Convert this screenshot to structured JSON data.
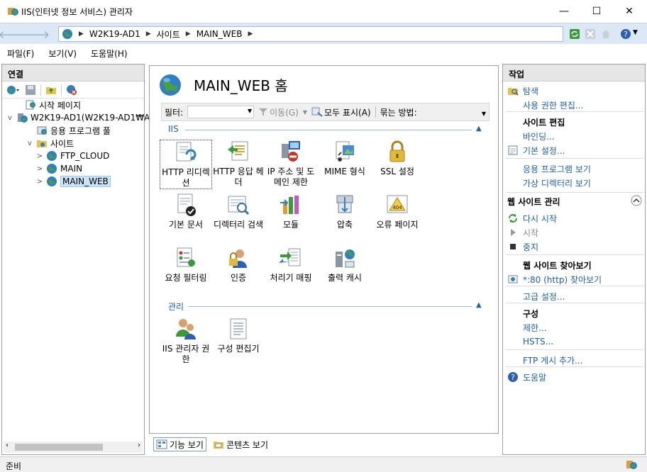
{
  "window": {
    "title": "IIS(인터넷 정보 서비스) 관리자",
    "icon": "iis-manager-icon"
  },
  "window_controls": {
    "minimize": "—",
    "maximize": "☐",
    "close": "✕"
  },
  "address": {
    "crumbs": [
      "W2K19-AD1",
      "사이트",
      "MAIN_WEB"
    ]
  },
  "menu": [
    "파일(F)",
    "보기(V)",
    "도움말(H)"
  ],
  "connections": {
    "title": "연결",
    "tree": [
      {
        "label": "시작 페이지",
        "icon": "start-page-icon",
        "level": 1,
        "expander": ""
      },
      {
        "label": "W2K19-AD1(W2K19-AD1₩A",
        "icon": "server-icon",
        "level": 0,
        "expander": "v"
      },
      {
        "label": "응용 프로그램 풀",
        "icon": "app-pool-icon",
        "level": 2,
        "expander": ""
      },
      {
        "label": "사이트",
        "icon": "sites-folder-icon",
        "level": 2,
        "expander": "v"
      },
      {
        "label": "FTP_CLOUD",
        "icon": "globe-icon",
        "level": 3,
        "expander": ">"
      },
      {
        "label": "MAIN",
        "icon": "globe-icon",
        "level": 3,
        "expander": ">"
      },
      {
        "label": "MAIN_WEB",
        "icon": "globe-icon",
        "level": 3,
        "expander": ">",
        "selected": true
      }
    ]
  },
  "center": {
    "title": "MAIN_WEB 홈",
    "filter": {
      "label": "필터:",
      "go": "이동(G)",
      "show_all": "모두 표시(A)",
      "group_by": "묶는 방법:"
    },
    "groups": [
      {
        "name": "IIS"
      },
      {
        "name": "관리"
      }
    ],
    "iis_features": [
      {
        "label": "HTTP 리디렉션",
        "icon": "http-redirect-icon",
        "selected": true
      },
      {
        "label": "HTTP 응답 헤더",
        "icon": "http-response-headers-icon"
      },
      {
        "label": "IP 주소 및 도메인 제한",
        "icon": "ip-domain-restrictions-icon"
      },
      {
        "label": "MIME 형식",
        "icon": "mime-types-icon"
      },
      {
        "label": "SSL 설정",
        "icon": "ssl-lock-icon"
      },
      {
        "label": "기본 문서",
        "icon": "default-document-icon"
      },
      {
        "label": "디렉터리 검색",
        "icon": "directory-browsing-icon"
      },
      {
        "label": "모듈",
        "icon": "modules-icon"
      },
      {
        "label": "압축",
        "icon": "compression-icon"
      },
      {
        "label": "오류 페이지",
        "icon": "error-pages-icon"
      },
      {
        "label": "요청 필터링",
        "icon": "request-filtering-icon"
      },
      {
        "label": "인증",
        "icon": "authentication-icon"
      },
      {
        "label": "처리기 매핑",
        "icon": "handler-mappings-icon"
      },
      {
        "label": "출력 캐시",
        "icon": "output-caching-icon"
      }
    ],
    "mgmt_features": [
      {
        "label": "IIS 관리자 권한",
        "icon": "iis-manager-permissions-icon"
      },
      {
        "label": "구성 편집기",
        "icon": "configuration-editor-icon"
      }
    ],
    "tabs": [
      "기능 보기",
      "콘텐츠 보기"
    ]
  },
  "actions": {
    "title": "작업",
    "items": [
      {
        "label": "탐색",
        "kind": "link",
        "icon": "explore-icon"
      },
      {
        "label": "사용 권한 편집...",
        "kind": "link",
        "icon": ""
      },
      {
        "label": "사이트 편집",
        "kind": "head",
        "icon": ""
      },
      {
        "label": "바인딩...",
        "kind": "link",
        "icon": ""
      },
      {
        "label": "기본 설정...",
        "kind": "link",
        "icon": "basic-settings-icon"
      },
      {
        "label": "응용 프로그램 보기",
        "kind": "link",
        "icon": ""
      },
      {
        "label": "가상 디렉터리 보기",
        "kind": "link",
        "icon": ""
      },
      {
        "label": "웹 사이트 관리",
        "kind": "section",
        "icon": "collapse-icon"
      },
      {
        "label": "다시 시작",
        "kind": "link",
        "icon": "restart-icon"
      },
      {
        "label": "시작",
        "kind": "disabled",
        "icon": "start-icon"
      },
      {
        "label": "중지",
        "kind": "link",
        "icon": "stop-icon"
      },
      {
        "label": "웹 사이트 찾아보기",
        "kind": "head",
        "icon": ""
      },
      {
        "label": "*:80 (http) 찾아보기",
        "kind": "link",
        "icon": "browse-icon"
      },
      {
        "label": "고급 설정...",
        "kind": "link",
        "icon": ""
      },
      {
        "label": "구성",
        "kind": "head",
        "icon": ""
      },
      {
        "label": "제한...",
        "kind": "link",
        "icon": ""
      },
      {
        "label": "HSTS...",
        "kind": "link",
        "icon": ""
      },
      {
        "label": "FTP 게시 추가...",
        "kind": "link",
        "icon": ""
      },
      {
        "label": "도움말",
        "kind": "link",
        "icon": "help-icon"
      }
    ]
  },
  "status": {
    "text": "준비"
  },
  "colors": {
    "link": "#1e5fae",
    "address_bar": "#dce8f5",
    "group_line": "#9cb8d8"
  }
}
